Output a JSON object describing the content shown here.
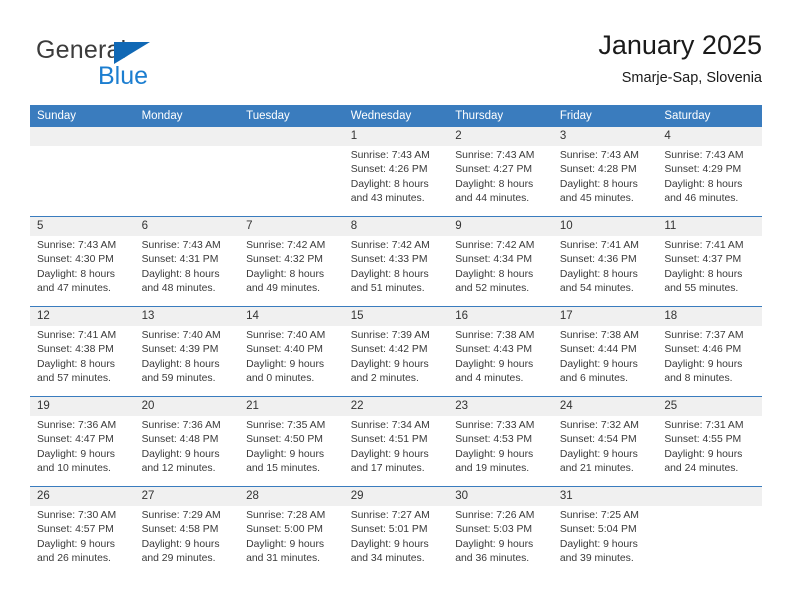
{
  "brand": {
    "name_top": "General",
    "name_bottom": "Blue",
    "triangle_icon": "triangle-icon",
    "color_dark": "#3c3c3c",
    "color_blue": "#1c7ed0"
  },
  "header": {
    "title": "January 2025",
    "subtitle": "Smarje-Sap, Slovenia"
  },
  "theme": {
    "header_bg": "#3a7cbe",
    "header_text": "#ffffff",
    "daynum_bg": "#f0f0f0",
    "grid_line": "#3a7cbe"
  },
  "calendar": {
    "weekday_headers": [
      "Sunday",
      "Monday",
      "Tuesday",
      "Wednesday",
      "Thursday",
      "Friday",
      "Saturday"
    ],
    "weeks": [
      [
        {
          "day": "",
          "lines": []
        },
        {
          "day": "",
          "lines": []
        },
        {
          "day": "",
          "lines": []
        },
        {
          "day": "1",
          "lines": [
            "Sunrise: 7:43 AM",
            "Sunset: 4:26 PM",
            "Daylight: 8 hours",
            "and 43 minutes."
          ]
        },
        {
          "day": "2",
          "lines": [
            "Sunrise: 7:43 AM",
            "Sunset: 4:27 PM",
            "Daylight: 8 hours",
            "and 44 minutes."
          ]
        },
        {
          "day": "3",
          "lines": [
            "Sunrise: 7:43 AM",
            "Sunset: 4:28 PM",
            "Daylight: 8 hours",
            "and 45 minutes."
          ]
        },
        {
          "day": "4",
          "lines": [
            "Sunrise: 7:43 AM",
            "Sunset: 4:29 PM",
            "Daylight: 8 hours",
            "and 46 minutes."
          ]
        }
      ],
      [
        {
          "day": "5",
          "lines": [
            "Sunrise: 7:43 AM",
            "Sunset: 4:30 PM",
            "Daylight: 8 hours",
            "and 47 minutes."
          ]
        },
        {
          "day": "6",
          "lines": [
            "Sunrise: 7:43 AM",
            "Sunset: 4:31 PM",
            "Daylight: 8 hours",
            "and 48 minutes."
          ]
        },
        {
          "day": "7",
          "lines": [
            "Sunrise: 7:42 AM",
            "Sunset: 4:32 PM",
            "Daylight: 8 hours",
            "and 49 minutes."
          ]
        },
        {
          "day": "8",
          "lines": [
            "Sunrise: 7:42 AM",
            "Sunset: 4:33 PM",
            "Daylight: 8 hours",
            "and 51 minutes."
          ]
        },
        {
          "day": "9",
          "lines": [
            "Sunrise: 7:42 AM",
            "Sunset: 4:34 PM",
            "Daylight: 8 hours",
            "and 52 minutes."
          ]
        },
        {
          "day": "10",
          "lines": [
            "Sunrise: 7:41 AM",
            "Sunset: 4:36 PM",
            "Daylight: 8 hours",
            "and 54 minutes."
          ]
        },
        {
          "day": "11",
          "lines": [
            "Sunrise: 7:41 AM",
            "Sunset: 4:37 PM",
            "Daylight: 8 hours",
            "and 55 minutes."
          ]
        }
      ],
      [
        {
          "day": "12",
          "lines": [
            "Sunrise: 7:41 AM",
            "Sunset: 4:38 PM",
            "Daylight: 8 hours",
            "and 57 minutes."
          ]
        },
        {
          "day": "13",
          "lines": [
            "Sunrise: 7:40 AM",
            "Sunset: 4:39 PM",
            "Daylight: 8 hours",
            "and 59 minutes."
          ]
        },
        {
          "day": "14",
          "lines": [
            "Sunrise: 7:40 AM",
            "Sunset: 4:40 PM",
            "Daylight: 9 hours",
            "and 0 minutes."
          ]
        },
        {
          "day": "15",
          "lines": [
            "Sunrise: 7:39 AM",
            "Sunset: 4:42 PM",
            "Daylight: 9 hours",
            "and 2 minutes."
          ]
        },
        {
          "day": "16",
          "lines": [
            "Sunrise: 7:38 AM",
            "Sunset: 4:43 PM",
            "Daylight: 9 hours",
            "and 4 minutes."
          ]
        },
        {
          "day": "17",
          "lines": [
            "Sunrise: 7:38 AM",
            "Sunset: 4:44 PM",
            "Daylight: 9 hours",
            "and 6 minutes."
          ]
        },
        {
          "day": "18",
          "lines": [
            "Sunrise: 7:37 AM",
            "Sunset: 4:46 PM",
            "Daylight: 9 hours",
            "and 8 minutes."
          ]
        }
      ],
      [
        {
          "day": "19",
          "lines": [
            "Sunrise: 7:36 AM",
            "Sunset: 4:47 PM",
            "Daylight: 9 hours",
            "and 10 minutes."
          ]
        },
        {
          "day": "20",
          "lines": [
            "Sunrise: 7:36 AM",
            "Sunset: 4:48 PM",
            "Daylight: 9 hours",
            "and 12 minutes."
          ]
        },
        {
          "day": "21",
          "lines": [
            "Sunrise: 7:35 AM",
            "Sunset: 4:50 PM",
            "Daylight: 9 hours",
            "and 15 minutes."
          ]
        },
        {
          "day": "22",
          "lines": [
            "Sunrise: 7:34 AM",
            "Sunset: 4:51 PM",
            "Daylight: 9 hours",
            "and 17 minutes."
          ]
        },
        {
          "day": "23",
          "lines": [
            "Sunrise: 7:33 AM",
            "Sunset: 4:53 PM",
            "Daylight: 9 hours",
            "and 19 minutes."
          ]
        },
        {
          "day": "24",
          "lines": [
            "Sunrise: 7:32 AM",
            "Sunset: 4:54 PM",
            "Daylight: 9 hours",
            "and 21 minutes."
          ]
        },
        {
          "day": "25",
          "lines": [
            "Sunrise: 7:31 AM",
            "Sunset: 4:55 PM",
            "Daylight: 9 hours",
            "and 24 minutes."
          ]
        }
      ],
      [
        {
          "day": "26",
          "lines": [
            "Sunrise: 7:30 AM",
            "Sunset: 4:57 PM",
            "Daylight: 9 hours",
            "and 26 minutes."
          ]
        },
        {
          "day": "27",
          "lines": [
            "Sunrise: 7:29 AM",
            "Sunset: 4:58 PM",
            "Daylight: 9 hours",
            "and 29 minutes."
          ]
        },
        {
          "day": "28",
          "lines": [
            "Sunrise: 7:28 AM",
            "Sunset: 5:00 PM",
            "Daylight: 9 hours",
            "and 31 minutes."
          ]
        },
        {
          "day": "29",
          "lines": [
            "Sunrise: 7:27 AM",
            "Sunset: 5:01 PM",
            "Daylight: 9 hours",
            "and 34 minutes."
          ]
        },
        {
          "day": "30",
          "lines": [
            "Sunrise: 7:26 AM",
            "Sunset: 5:03 PM",
            "Daylight: 9 hours",
            "and 36 minutes."
          ]
        },
        {
          "day": "31",
          "lines": [
            "Sunrise: 7:25 AM",
            "Sunset: 5:04 PM",
            "Daylight: 9 hours",
            "and 39 minutes."
          ]
        },
        {
          "day": "",
          "lines": []
        }
      ]
    ]
  }
}
